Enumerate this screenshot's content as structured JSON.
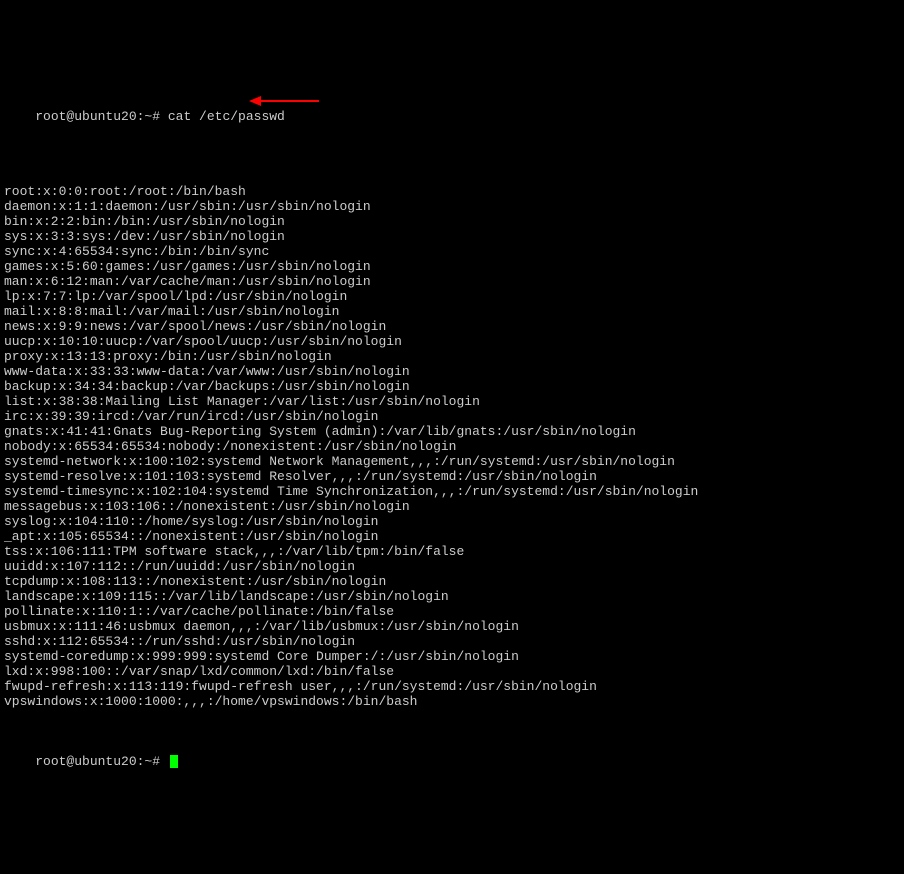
{
  "terminal": {
    "prompt1": "root@ubuntu20:~# ",
    "command": "cat /etc/passwd",
    "lines": [
      "root:x:0:0:root:/root:/bin/bash",
      "daemon:x:1:1:daemon:/usr/sbin:/usr/sbin/nologin",
      "bin:x:2:2:bin:/bin:/usr/sbin/nologin",
      "sys:x:3:3:sys:/dev:/usr/sbin/nologin",
      "sync:x:4:65534:sync:/bin:/bin/sync",
      "games:x:5:60:games:/usr/games:/usr/sbin/nologin",
      "man:x:6:12:man:/var/cache/man:/usr/sbin/nologin",
      "lp:x:7:7:lp:/var/spool/lpd:/usr/sbin/nologin",
      "mail:x:8:8:mail:/var/mail:/usr/sbin/nologin",
      "news:x:9:9:news:/var/spool/news:/usr/sbin/nologin",
      "uucp:x:10:10:uucp:/var/spool/uucp:/usr/sbin/nologin",
      "proxy:x:13:13:proxy:/bin:/usr/sbin/nologin",
      "www-data:x:33:33:www-data:/var/www:/usr/sbin/nologin",
      "backup:x:34:34:backup:/var/backups:/usr/sbin/nologin",
      "list:x:38:38:Mailing List Manager:/var/list:/usr/sbin/nologin",
      "irc:x:39:39:ircd:/var/run/ircd:/usr/sbin/nologin",
      "gnats:x:41:41:Gnats Bug-Reporting System (admin):/var/lib/gnats:/usr/sbin/nologin",
      "nobody:x:65534:65534:nobody:/nonexistent:/usr/sbin/nologin",
      "systemd-network:x:100:102:systemd Network Management,,,:/run/systemd:/usr/sbin/nologin",
      "systemd-resolve:x:101:103:systemd Resolver,,,:/run/systemd:/usr/sbin/nologin",
      "systemd-timesync:x:102:104:systemd Time Synchronization,,,:/run/systemd:/usr/sbin/nologin",
      "messagebus:x:103:106::/nonexistent:/usr/sbin/nologin",
      "syslog:x:104:110::/home/syslog:/usr/sbin/nologin",
      "_apt:x:105:65534::/nonexistent:/usr/sbin/nologin",
      "tss:x:106:111:TPM software stack,,,:/var/lib/tpm:/bin/false",
      "uuidd:x:107:112::/run/uuidd:/usr/sbin/nologin",
      "tcpdump:x:108:113::/nonexistent:/usr/sbin/nologin",
      "landscape:x:109:115::/var/lib/landscape:/usr/sbin/nologin",
      "pollinate:x:110:1::/var/cache/pollinate:/bin/false",
      "usbmux:x:111:46:usbmux daemon,,,:/var/lib/usbmux:/usr/sbin/nologin",
      "sshd:x:112:65534::/run/sshd:/usr/sbin/nologin",
      "systemd-coredump:x:999:999:systemd Core Dumper:/:/usr/sbin/nologin",
      "lxd:x:998:100::/var/snap/lxd/common/lxd:/bin/false",
      "fwupd-refresh:x:113:119:fwupd-refresh user,,,:/run/systemd:/usr/sbin/nologin",
      "vpswindows:x:1000:1000:,,,:/home/vpswindows:/bin/bash"
    ],
    "prompt2": "root@ubuntu20:~# "
  }
}
